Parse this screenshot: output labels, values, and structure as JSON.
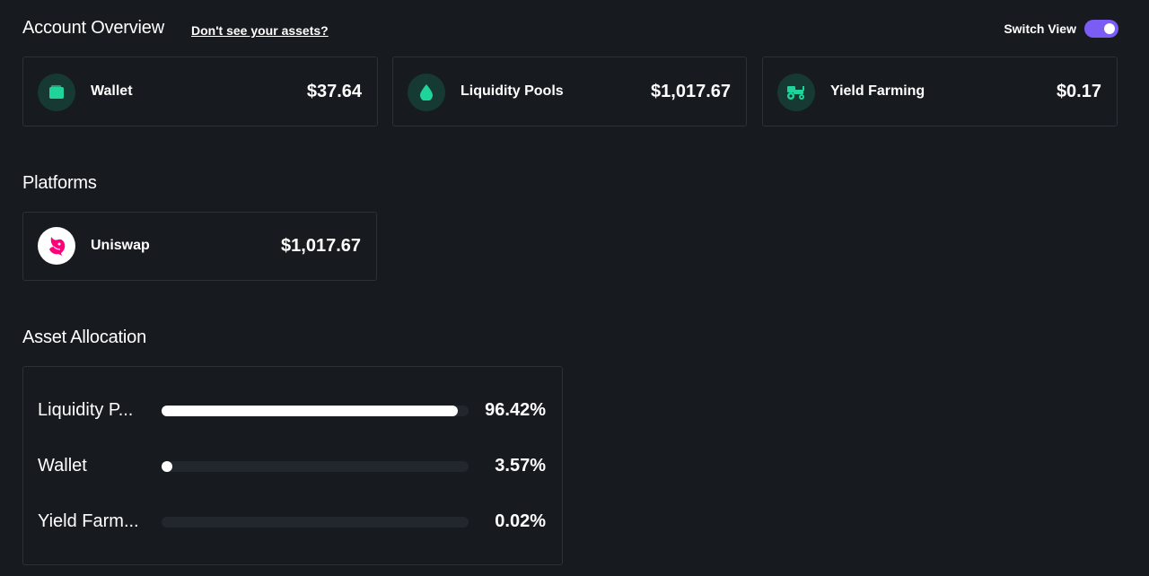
{
  "header": {
    "title": "Account Overview",
    "help_link": "Don't see your assets?",
    "switch_view_label": "Switch View",
    "switch_view_on": true
  },
  "overview_cards": [
    {
      "label": "Wallet",
      "value": "$37.64",
      "icon": "wallet-icon"
    },
    {
      "label": "Liquidity Pools",
      "value": "$1,017.67",
      "icon": "droplet-icon"
    },
    {
      "label": "Yield Farming",
      "value": "$0.17",
      "icon": "tractor-icon"
    }
  ],
  "platforms": {
    "title": "Platforms",
    "items": [
      {
        "label": "Uniswap",
        "value": "$1,017.67",
        "icon": "uniswap-logo-icon"
      }
    ]
  },
  "allocation": {
    "title": "Asset Allocation",
    "rows": [
      {
        "label": "Liquidity P...",
        "percent": "96.42%",
        "fraction": 0.9642
      },
      {
        "label": "Wallet",
        "percent": "3.57%",
        "fraction": 0.0357
      },
      {
        "label": "Yield Farm...",
        "percent": "0.02%",
        "fraction": 0.0002
      }
    ]
  },
  "colors": {
    "background": "#171b20",
    "card_border": "#2b3138",
    "accent_green": "#1fd49a",
    "icon_bg": "#163a33",
    "toggle": "#7b5cf5",
    "uniswap_pink": "#ff007a"
  }
}
